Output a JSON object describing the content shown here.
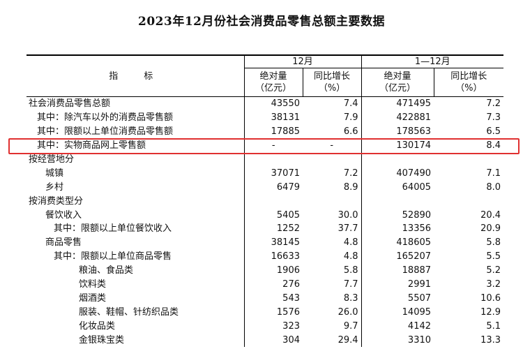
{
  "title": "2023年12月份社会消费品零售总额主要数据",
  "header": {
    "indicator": "指　标",
    "period_dec": "12月",
    "period_ytd": "1—12月",
    "abs_label": "绝对量\n（亿元）",
    "yoy_label": "同比增长\n（%）"
  },
  "rows": [
    {
      "name": "社会消费品零售总额",
      "dec_abs": "43550",
      "dec_yoy": "7.4",
      "ytd_abs": "471495",
      "ytd_yoy": "7.2"
    },
    {
      "name": "其中：除汽车以外的消费品零售额",
      "dec_abs": "38131",
      "dec_yoy": "7.9",
      "ytd_abs": "422881",
      "ytd_yoy": "7.3"
    },
    {
      "name": "其中：限额以上单位消费品零售额",
      "dec_abs": "17885",
      "dec_yoy": "6.6",
      "ytd_abs": "178563",
      "ytd_yoy": "6.5"
    },
    {
      "name": "其中：实物商品网上零售额",
      "dec_abs": "-",
      "dec_yoy": "-",
      "ytd_abs": "130174",
      "ytd_yoy": "8.4"
    },
    {
      "name": "按经营地分",
      "dec_abs": "",
      "dec_yoy": "",
      "ytd_abs": "",
      "ytd_yoy": ""
    },
    {
      "name": "城镇",
      "dec_abs": "37071",
      "dec_yoy": "7.2",
      "ytd_abs": "407490",
      "ytd_yoy": "7.1"
    },
    {
      "name": "乡村",
      "dec_abs": "6479",
      "dec_yoy": "8.9",
      "ytd_abs": "64005",
      "ytd_yoy": "8.0"
    },
    {
      "name": "按消费类型分",
      "dec_abs": "",
      "dec_yoy": "",
      "ytd_abs": "",
      "ytd_yoy": ""
    },
    {
      "name": "餐饮收入",
      "dec_abs": "5405",
      "dec_yoy": "30.0",
      "ytd_abs": "52890",
      "ytd_yoy": "20.4"
    },
    {
      "name": "其中：限额以上单位餐饮收入",
      "dec_abs": "1252",
      "dec_yoy": "37.7",
      "ytd_abs": "13356",
      "ytd_yoy": "20.9"
    },
    {
      "name": "商品零售",
      "dec_abs": "38145",
      "dec_yoy": "4.8",
      "ytd_abs": "418605",
      "ytd_yoy": "5.8"
    },
    {
      "name": "其中：限额以上单位商品零售",
      "dec_abs": "16633",
      "dec_yoy": "4.8",
      "ytd_abs": "165207",
      "ytd_yoy": "5.5"
    },
    {
      "name": "粮油、食品类",
      "dec_abs": "1906",
      "dec_yoy": "5.8",
      "ytd_abs": "18887",
      "ytd_yoy": "5.2"
    },
    {
      "name": "饮料类",
      "dec_abs": "276",
      "dec_yoy": "7.7",
      "ytd_abs": "2991",
      "ytd_yoy": "3.2"
    },
    {
      "name": "烟酒类",
      "dec_abs": "543",
      "dec_yoy": "8.3",
      "ytd_abs": "5507",
      "ytd_yoy": "10.6"
    },
    {
      "name": "服装、鞋帽、针纺织品类",
      "dec_abs": "1576",
      "dec_yoy": "26.0",
      "ytd_abs": "14095",
      "ytd_yoy": "12.9"
    },
    {
      "name": "化妆品类",
      "dec_abs": "323",
      "dec_yoy": "9.7",
      "ytd_abs": "4142",
      "ytd_yoy": "5.1"
    },
    {
      "name": "金银珠宝类",
      "dec_abs": "304",
      "dec_yoy": "29.4",
      "ytd_abs": "3310",
      "ytd_yoy": "13.3"
    }
  ],
  "highlight_color": "#e03030"
}
